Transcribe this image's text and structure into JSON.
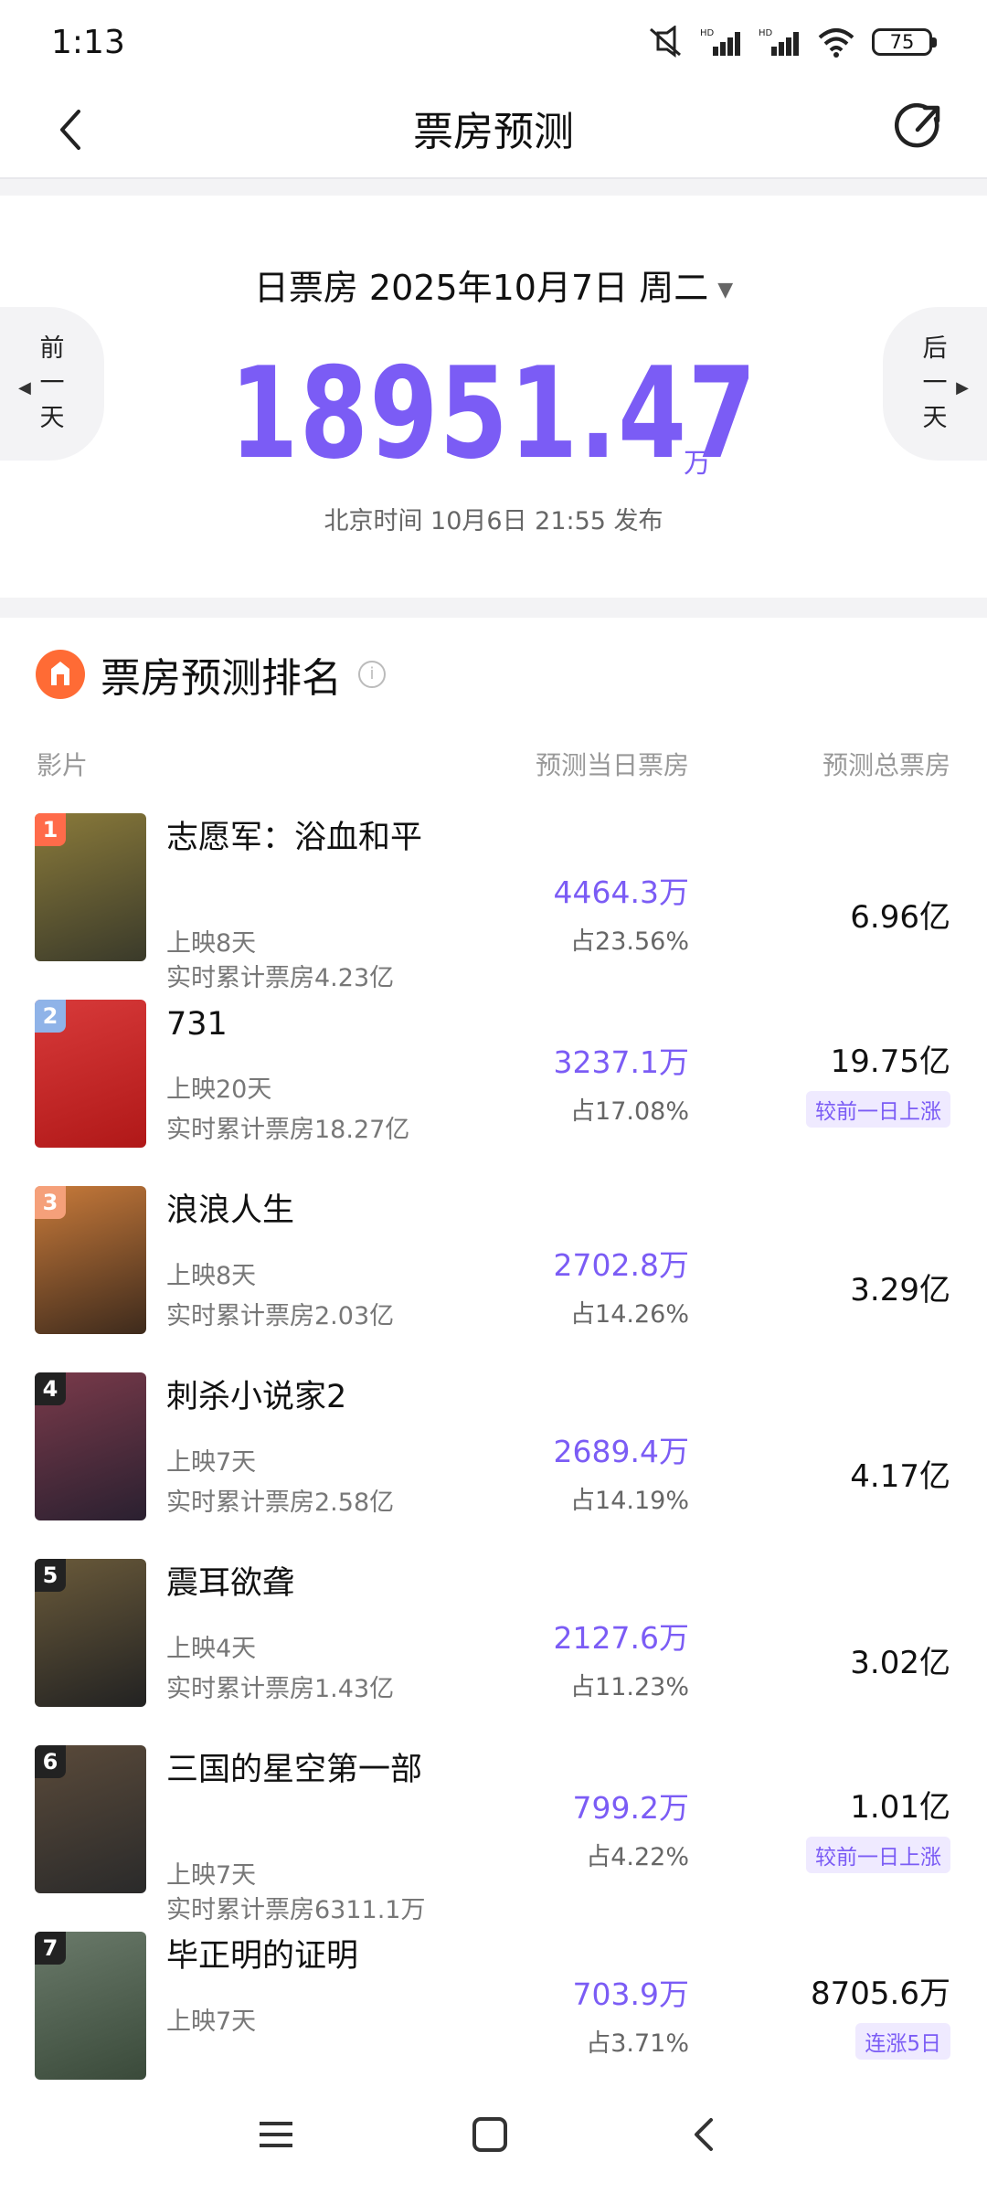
{
  "status": {
    "time": "1:13",
    "battery": "75",
    "net1": "HD",
    "net2": "HD"
  },
  "nav": {
    "title": "票房预测"
  },
  "summary": {
    "date_label": "日票房 2025年10月7日 周二",
    "amount": "18951.47",
    "unit": "万",
    "publish": "北京时间 10月6日 21:55 发布",
    "prev": [
      "前",
      "一",
      "天"
    ],
    "next": [
      "后",
      "一",
      "天"
    ]
  },
  "ranking": {
    "title": "票房预测排名",
    "col_film": "影片",
    "col_daily": "预测当日票房",
    "col_total": "预测总票房",
    "films": [
      {
        "rank": "1",
        "title": "志愿军：浴血和平",
        "days": "上映8天",
        "cum": "实时累计票房4.23亿",
        "daily": "4464.3万",
        "share": "占23.56%",
        "total": "6.96亿",
        "badge": ""
      },
      {
        "rank": "2",
        "title": "731",
        "days": "上映20天",
        "cum": "实时累计票房18.27亿",
        "daily": "3237.1万",
        "share": "占17.08%",
        "total": "19.75亿",
        "badge": "较前一日上涨"
      },
      {
        "rank": "3",
        "title": "浪浪人生",
        "days": "上映8天",
        "cum": "实时累计票房2.03亿",
        "daily": "2702.8万",
        "share": "占14.26%",
        "total": "3.29亿",
        "badge": ""
      },
      {
        "rank": "4",
        "title": "刺杀小说家2",
        "days": "上映7天",
        "cum": "实时累计票房2.58亿",
        "daily": "2689.4万",
        "share": "占14.19%",
        "total": "4.17亿",
        "badge": ""
      },
      {
        "rank": "5",
        "title": "震耳欲聋",
        "days": "上映4天",
        "cum": "实时累计票房1.43亿",
        "daily": "2127.6万",
        "share": "占11.23%",
        "total": "3.02亿",
        "badge": ""
      },
      {
        "rank": "6",
        "title": "三国的星空第一部",
        "days": "上映7天",
        "cum": "实时累计票房6311.1万",
        "daily": "799.2万",
        "share": "占4.22%",
        "total": "1.01亿",
        "badge": "较前一日上涨"
      },
      {
        "rank": "7",
        "title": "毕正明的证明",
        "days": "上映7天",
        "cum": "",
        "daily": "703.9万",
        "share": "占3.71%",
        "total": "8705.6万",
        "badge": "连涨5日"
      }
    ]
  },
  "colors": {
    "accent": "#7b5cf5",
    "badge1": "#ff6b4a",
    "badge2": "#8fb3e8",
    "badge3": "#f5a07a",
    "badge_other": "#222222"
  },
  "icons": {
    "back": "chevron-left-icon",
    "share": "share-icon",
    "info": "info-icon",
    "menu": "menu-icon",
    "home": "home-icon",
    "nav_back": "back-icon"
  }
}
